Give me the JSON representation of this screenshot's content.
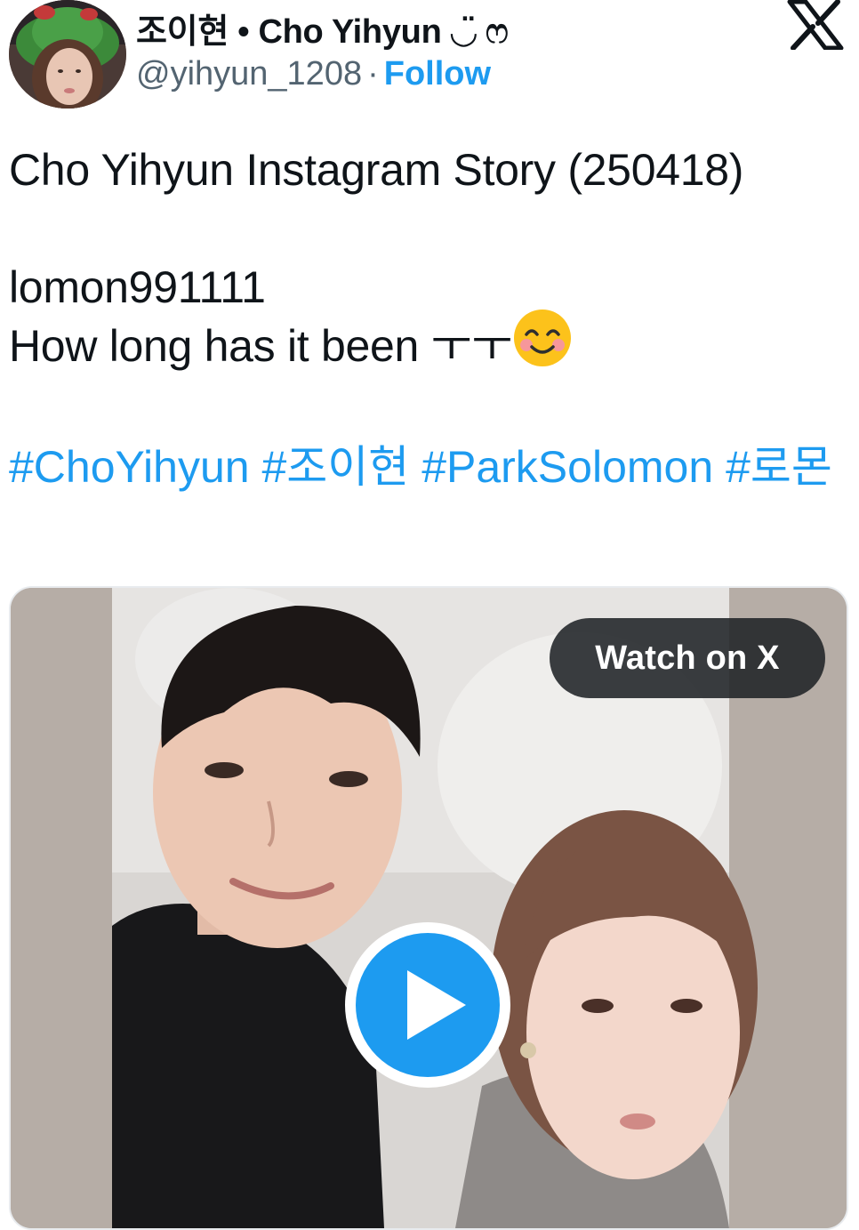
{
  "author": {
    "display_name": "조이현 • Cho Yihyun ◡̈ ෆ",
    "handle": "@yihyun_1208",
    "separator": "·",
    "follow_label": "Follow"
  },
  "icons": {
    "logo": "x-logo-icon",
    "avatar": "avatar-image",
    "emoji": "smiling-face-with-blush-emoji",
    "play": "play-icon"
  },
  "tweet": {
    "line1": "Cho Yihyun Instagram Story (250418)",
    "line2": "lomon991111",
    "line3": "How long has it been ㅜㅜ",
    "hashtags": [
      "#ChoYihyun",
      "#조이현",
      "#ParkSolomon",
      "#로몬"
    ]
  },
  "media": {
    "watch_label": "Watch on X"
  },
  "colors": {
    "accent": "#1d9bf0",
    "text": "#0f1419",
    "secondary": "#536471",
    "pill_bg": "#202327"
  }
}
